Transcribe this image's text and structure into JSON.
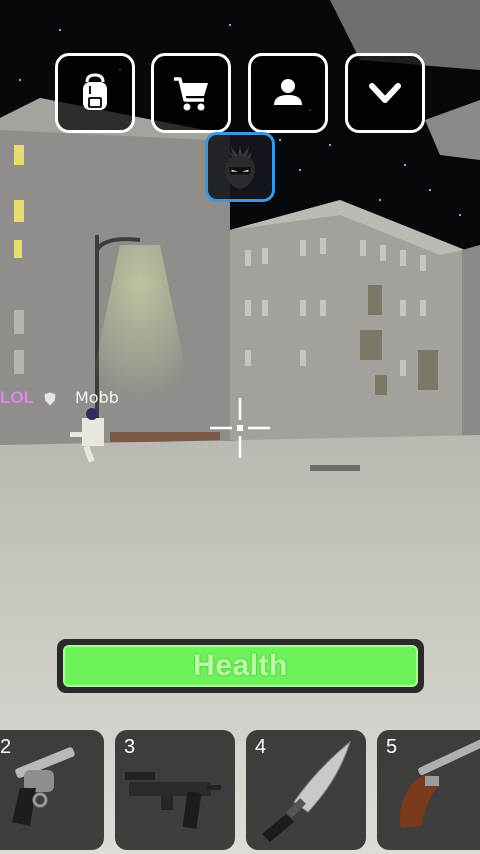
{
  "top_bar": {
    "buttons": [
      {
        "id": "inventory",
        "icon": "backpack-icon"
      },
      {
        "id": "shop",
        "icon": "cart-icon"
      },
      {
        "id": "profile",
        "icon": "user-icon"
      },
      {
        "id": "menu",
        "icon": "chevron-down-icon"
      }
    ],
    "team_badge": {
      "icon": "ninja-icon",
      "border_color": "#3a98e0"
    }
  },
  "players": [
    {
      "clan": "LOL",
      "name": "Mobb"
    }
  ],
  "crosshair": {
    "icon": "crosshair-icon"
  },
  "health": {
    "label": "Health",
    "value": 1.0,
    "color": "#6df25c"
  },
  "hotbar": {
    "slots": [
      {
        "number": "2",
        "icon": "revolver-icon"
      },
      {
        "number": "3",
        "icon": "uzi-icon"
      },
      {
        "number": "4",
        "icon": "knife-icon"
      },
      {
        "number": "5",
        "icon": "flintlock-pistol-icon"
      }
    ]
  }
}
